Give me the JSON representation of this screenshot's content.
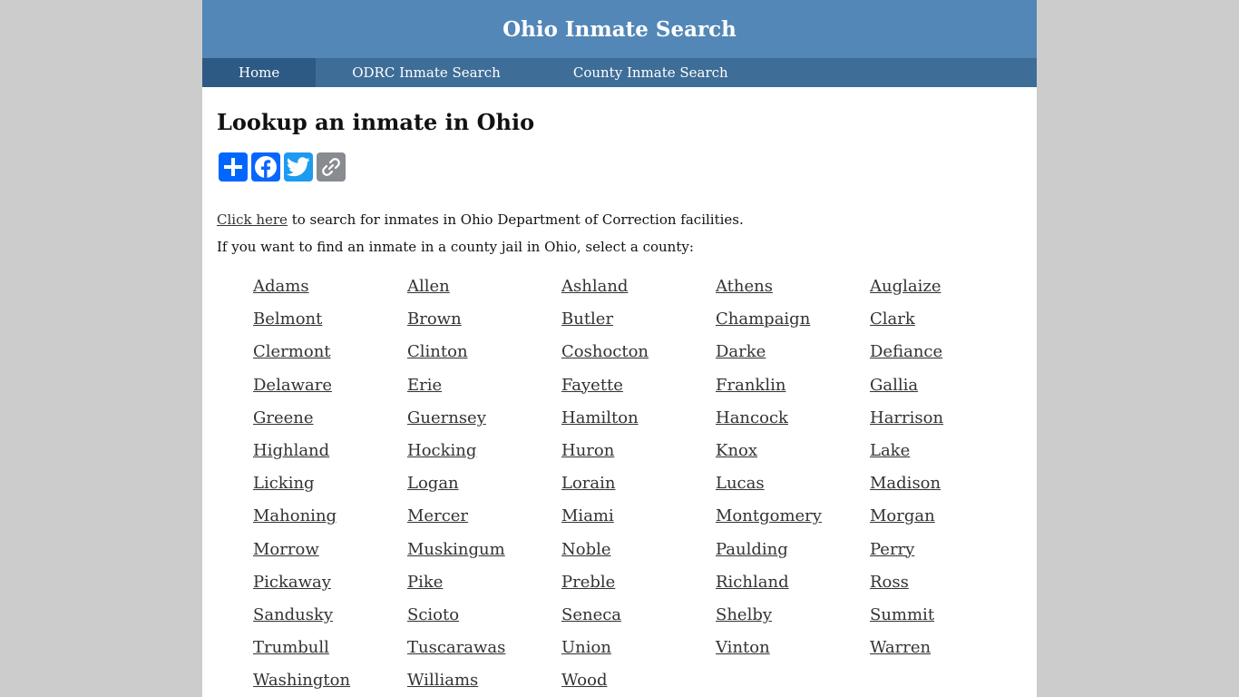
{
  "header": {
    "title": "Ohio Inmate Search"
  },
  "nav": {
    "home": "Home",
    "odrc": "ODRC Inmate Search",
    "county": "County Inmate Search"
  },
  "main": {
    "heading": "Lookup an inmate in Ohio",
    "share_icons": [
      "addtoany-share-icon",
      "facebook-icon",
      "twitter-icon",
      "copy-link-icon"
    ],
    "intro_link": "Click here",
    "intro_rest": " to search for inmates in Ohio Department of Correction facilities.",
    "prompt": "If you want to find an inmate in a county jail in Ohio, select a county:",
    "counties": [
      "Adams",
      "Allen",
      "Ashland",
      "Athens",
      "Auglaize",
      "Belmont",
      "Brown",
      "Butler",
      "Champaign",
      "Clark",
      "Clermont",
      "Clinton",
      "Coshocton",
      "Darke",
      "Defiance",
      "Delaware",
      "Erie",
      "Fayette",
      "Franklin",
      "Gallia",
      "Greene",
      "Guernsey",
      "Hamilton",
      "Hancock",
      "Harrison",
      "Highland",
      "Hocking",
      "Huron",
      "Knox",
      "Lake",
      "Licking",
      "Logan",
      "Lorain",
      "Lucas",
      "Madison",
      "Mahoning",
      "Mercer",
      "Miami",
      "Montgomery",
      "Morgan",
      "Morrow",
      "Muskingum",
      "Noble",
      "Paulding",
      "Perry",
      "Pickaway",
      "Pike",
      "Preble",
      "Richland",
      "Ross",
      "Sandusky",
      "Scioto",
      "Seneca",
      "Shelby",
      "Summit",
      "Trumbull",
      "Tuscarawas",
      "Union",
      "Vinton",
      "Warren",
      "Washington",
      "Williams",
      "Wood"
    ]
  },
  "colors": {
    "header_bg": "#5287b7",
    "nav_bg": "#3e6d97",
    "nav_active_bg": "#2d5a84",
    "page_bg": "#cccccc"
  }
}
